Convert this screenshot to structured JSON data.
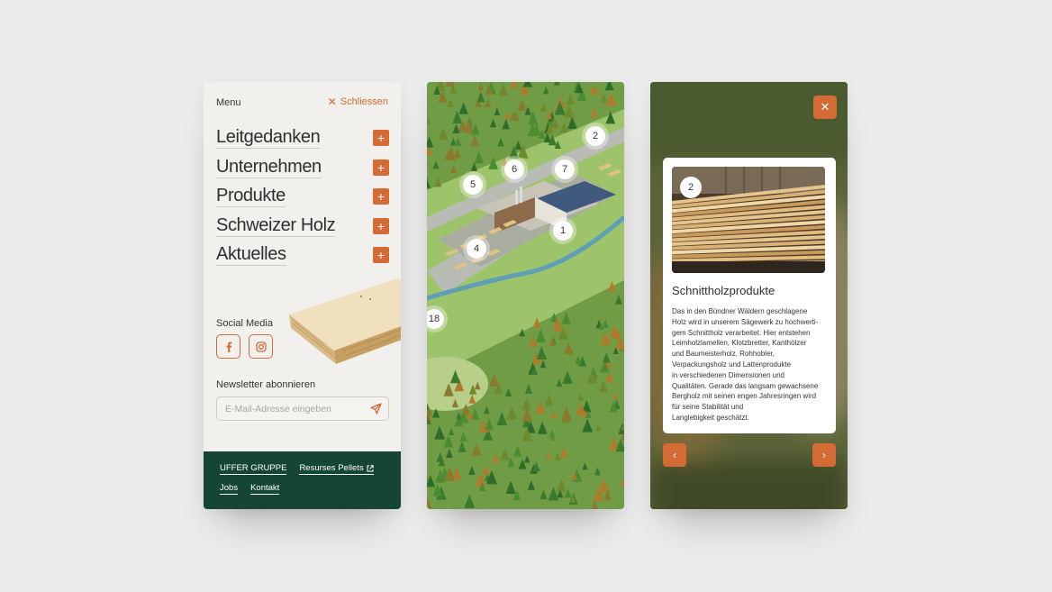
{
  "menu": {
    "title": "Menu",
    "close_label": "Schliessen",
    "items": [
      {
        "label": "Leitgedanken"
      },
      {
        "label": "Unternehmen"
      },
      {
        "label": "Produkte"
      },
      {
        "label": "Schweizer Holz"
      },
      {
        "label": "Aktuelles"
      }
    ],
    "social_title": "Social Media",
    "social": [
      "facebook-icon",
      "instagram-icon"
    ],
    "newsletter_title": "Newsletter abonnieren",
    "newsletter_placeholder": "E-Mail-Adresse eingeben",
    "footer_links": [
      "UFFER GRUPPE",
      "Resurses Pellets",
      "Jobs",
      "Kontakt"
    ]
  },
  "map": {
    "pins": [
      "2",
      "6",
      "7",
      "5",
      "1",
      "4",
      "18"
    ]
  },
  "detail": {
    "pin": "2",
    "title": "Schnittholzprodukte",
    "text": "Das in den Bündner Wäldern geschlagene\nHolz wird in unserem Sägewerk zu hochwerti-\ngem Schnittholz verarbeitet. Hier entstehen\nLeimholzlamellen, Klotzbretter, Kanthölzer\nund Baumeisterholz, Rohhobler,\nVerpackungsholz und Lattenprodukte\nin verschiedenen Dimensionen und\nQualitäten. Gerade das langsam gewachsene\nBergholz mit seinen engen Jahresringen wird\nfür seine Stabilität und\nLanglebigkeit geschätzt."
  },
  "colors": {
    "accent": "#d46a34",
    "footer": "#154634",
    "menu_bg": "#f2f0ed"
  }
}
